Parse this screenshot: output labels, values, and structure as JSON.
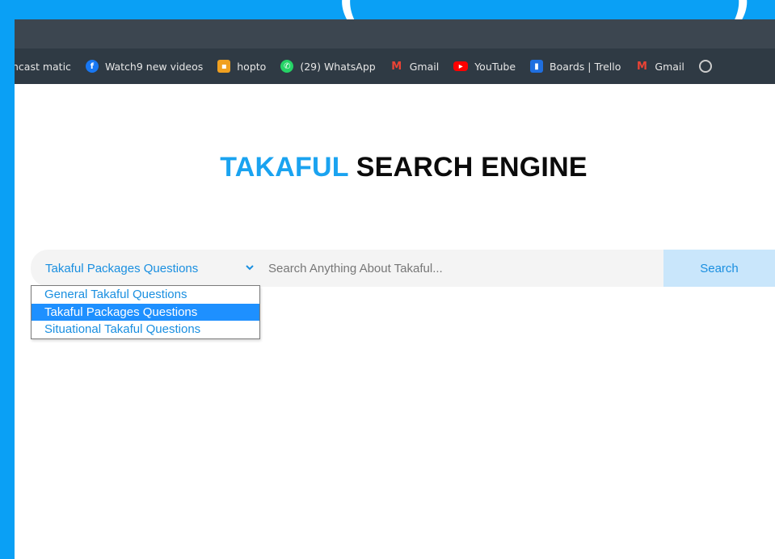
{
  "bookmarks": [
    {
      "label": "ncast matic",
      "icon": "none"
    },
    {
      "label": "Watch9 new videos",
      "icon": "facebook-icon"
    },
    {
      "label": "hopto",
      "icon": "hopto-icon"
    },
    {
      "label": "(29) WhatsApp",
      "icon": "whatsapp-icon"
    },
    {
      "label": "Gmail",
      "icon": "gmail-icon"
    },
    {
      "label": "YouTube",
      "icon": "youtube-icon"
    },
    {
      "label": "Boards | Trello",
      "icon": "trello-icon"
    },
    {
      "label": "Gmail",
      "icon": "gmail-icon"
    }
  ],
  "page": {
    "title_accent": "TAKAFUL",
    "title_rest": "SEARCH ENGINE"
  },
  "search": {
    "selected_category": "Takaful Packages Questions",
    "placeholder": "Search Anything About Takaful...",
    "button_label": "Search"
  },
  "dropdown": {
    "options": [
      "General Takaful Questions",
      "Takaful Packages Questions",
      "Situational Takaful Questions"
    ],
    "selected_index": 1
  },
  "colors": {
    "frame": "#0aa0f5",
    "accent": "#1aa3f0",
    "link": "#1a8fe0",
    "button_bg": "#c9e6fb",
    "highlight": "#1e90ff"
  }
}
